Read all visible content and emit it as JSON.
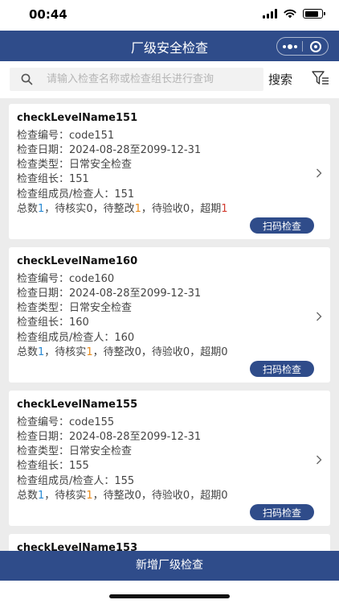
{
  "status_bar": {
    "time": "00:44"
  },
  "nav": {
    "title": "厂级安全检查"
  },
  "search": {
    "placeholder": "请输入检查名称或检查组长进行查询",
    "value": "",
    "button_label": "搜索"
  },
  "labels": {
    "code": "检查编号：",
    "date": "检查日期：",
    "type": "检查类型：",
    "leader": "检查组长：",
    "members": "检查组成员/检查人：",
    "total": "总数",
    "pending_verify": "，待核实",
    "pending_fix": "，待整改",
    "pending_accept": "，待验收",
    "overdue": "，超期",
    "scan_button": "扫码检查"
  },
  "cards": [
    {
      "name": "checkLevelName151",
      "code": "code151",
      "date": "2024-08-28至2099-12-31",
      "type": "日常安全检查",
      "leader": "151",
      "members": "151",
      "total": "1",
      "pending_verify": "0",
      "pending_fix": "1",
      "pending_accept": "0",
      "overdue": "1"
    },
    {
      "name": "checkLevelName160",
      "code": "code160",
      "date": "2024-08-28至2099-12-31",
      "type": "日常安全检查",
      "leader": "160",
      "members": "160",
      "total": "1",
      "pending_verify": "1",
      "pending_fix": "0",
      "pending_accept": "0",
      "overdue": "0"
    },
    {
      "name": "checkLevelName155",
      "code": "code155",
      "date": "2024-08-28至2099-12-31",
      "type": "日常安全检查",
      "leader": "155",
      "members": "155",
      "total": "1",
      "pending_verify": "1",
      "pending_fix": "0",
      "pending_accept": "0",
      "overdue": "0"
    },
    {
      "name": "checkLevelName153"
    }
  ],
  "footer": {
    "add_button": "新增厂级检查"
  },
  "colors": {
    "primary": "#2f4c8a",
    "count_blue": "#2a8ad4",
    "count_orange": "#e88a1a",
    "count_red": "#d23a2e"
  }
}
